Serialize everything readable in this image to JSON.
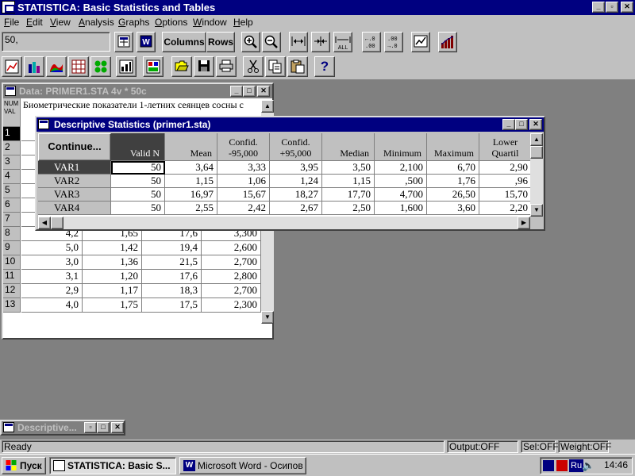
{
  "app": {
    "title": "STATISTICA: Basic Statistics and Tables"
  },
  "menu": [
    "File",
    "Edit",
    "View",
    "Analysis",
    "Graphs",
    "Options",
    "Window",
    "Help"
  ],
  "toolbar": {
    "value_box": "50,",
    "columns_label": "Columns",
    "rows_label": "Rows",
    "w_label": "W",
    "all_label": "ALL",
    "help_label": "?"
  },
  "data_window": {
    "title": "Data: PRIMER1.STA 4v * 50c",
    "corner_label_1": "NUM",
    "corner_label_2": "VAL",
    "header_text": "Биометрические показатели 1-летних сеянцев сосны с",
    "rows": [
      {
        "n": "1",
        "c": [
          "",
          "",
          "",
          ""
        ]
      },
      {
        "n": "2",
        "c": [
          "",
          "",
          "",
          ""
        ]
      },
      {
        "n": "3",
        "c": [
          "",
          "",
          "",
          ""
        ]
      },
      {
        "n": "4",
        "c": [
          "",
          "",
          "",
          ""
        ]
      },
      {
        "n": "5",
        "c": [
          "",
          "",
          "",
          ""
        ]
      },
      {
        "n": "6",
        "c": [
          "",
          "",
          "",
          ""
        ]
      },
      {
        "n": "7",
        "c": [
          "3,5",
          "1,25",
          "11,4",
          "2,800"
        ]
      },
      {
        "n": "8",
        "c": [
          "4,2",
          "1,65",
          "17,6",
          "3,300"
        ]
      },
      {
        "n": "9",
        "c": [
          "5,0",
          "1,42",
          "19,4",
          "2,600"
        ]
      },
      {
        "n": "10",
        "c": [
          "3,0",
          "1,36",
          "21,5",
          "2,700"
        ]
      },
      {
        "n": "11",
        "c": [
          "3,1",
          "1,20",
          "17,6",
          "2,800"
        ]
      },
      {
        "n": "12",
        "c": [
          "2,9",
          "1,17",
          "18,3",
          "2,700"
        ]
      },
      {
        "n": "13",
        "c": [
          "4,0",
          "1,75",
          "17,5",
          "2,300"
        ]
      }
    ]
  },
  "desc_window": {
    "title": "Descriptive Statistics (primer1.sta)",
    "continue_label": "Continue...",
    "headers": [
      {
        "l1": "",
        "l2": "Valid N"
      },
      {
        "l1": "",
        "l2": "Mean"
      },
      {
        "l1": "Confid.",
        "l2": "-95,000"
      },
      {
        "l1": "Confid.",
        "l2": "+95,000"
      },
      {
        "l1": "",
        "l2": "Median"
      },
      {
        "l1": "",
        "l2": "Minimum"
      },
      {
        "l1": "",
        "l2": "Maximum"
      },
      {
        "l1": "Lower",
        "l2": "Quartil"
      }
    ],
    "rows": [
      {
        "label": "VAR1",
        "values": [
          "50",
          "3,64",
          "3,33",
          "3,95",
          "3,50",
          "2,100",
          "6,70",
          "2,90"
        ]
      },
      {
        "label": "VAR2",
        "values": [
          "50",
          "1,15",
          "1,06",
          "1,24",
          "1,15",
          ",500",
          "1,76",
          ",96"
        ]
      },
      {
        "label": "VAR3",
        "values": [
          "50",
          "16,97",
          "15,67",
          "18,27",
          "17,70",
          "4,700",
          "26,50",
          "15,70"
        ]
      },
      {
        "label": "VAR4",
        "values": [
          "50",
          "2,55",
          "2,42",
          "2,67",
          "2,50",
          "1,600",
          "3,60",
          "2,20"
        ]
      }
    ]
  },
  "minimized_window": {
    "title": "Descriptive..."
  },
  "status": {
    "left": "Ready",
    "output": "Output:OFF",
    "sel": "Sel:OFF",
    "weight": "Weight:OFF"
  },
  "taskbar": {
    "start_label": "Пуск",
    "tasks": [
      "STATISTICA: Basic S...",
      "Microsoft Word - Осипов"
    ],
    "lang": "Ru",
    "clock": "14:46"
  }
}
